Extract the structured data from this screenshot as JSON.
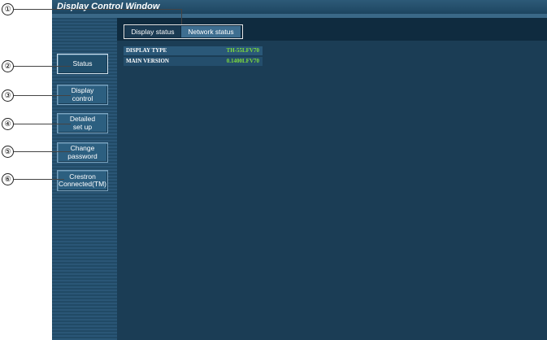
{
  "window": {
    "title": "Display Control Window"
  },
  "tabs": [
    {
      "label": "Display status"
    },
    {
      "label": "Network status"
    }
  ],
  "info": [
    {
      "label": "DISPLAY TYPE",
      "value": "TH-55LFV70"
    },
    {
      "label": "MAIN VERSION",
      "value": "0.1400LFV70"
    }
  ],
  "sidebar": {
    "items": [
      {
        "label": "Status"
      },
      {
        "label": "Display\ncontrol"
      },
      {
        "label": "Detailed\nset up"
      },
      {
        "label": "Change\npassword"
      },
      {
        "label": "Crestron\nConnected(TM)"
      }
    ]
  },
  "callouts": [
    "①",
    "②",
    "③",
    "④",
    "⑤",
    "⑥"
  ],
  "colors": {
    "background": "#1b3d55",
    "value_green": "#7fdc3c"
  }
}
